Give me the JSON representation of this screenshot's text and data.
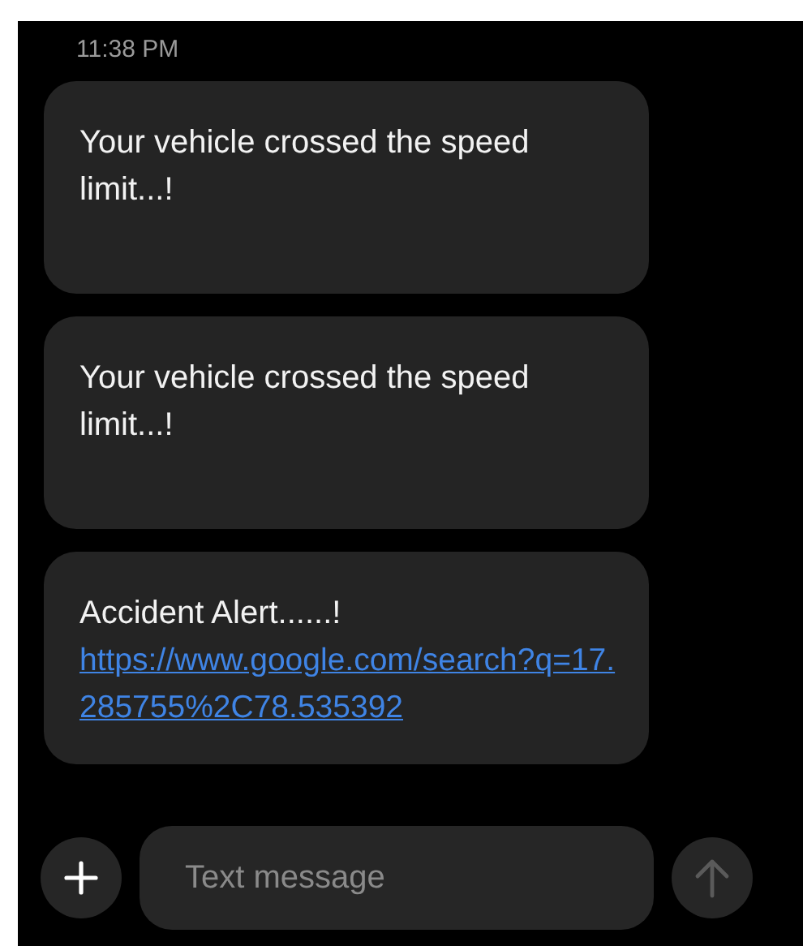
{
  "timestamp": "11:38 PM",
  "messages": [
    {
      "text": "Your vehicle crossed the speed limit...!"
    },
    {
      "text": "Your vehicle crossed the speed limit...!"
    },
    {
      "text": "Accident Alert......!",
      "link": "https://www.google.com/search?q=17.285755%2C78.535392"
    }
  ],
  "composer": {
    "placeholder": "Text message",
    "send_disabled": true
  }
}
